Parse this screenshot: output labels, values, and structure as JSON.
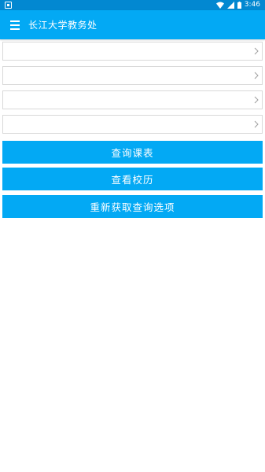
{
  "status_bar": {
    "time": "3:46",
    "icons": [
      "notification-icon",
      "wifi-icon",
      "signal-icon",
      "battery-icon"
    ]
  },
  "app_bar": {
    "title": "长江大学教务处",
    "menu_icon": "hamburger-menu-icon",
    "color": "#03a9f4"
  },
  "selectors": [
    {
      "value": ""
    },
    {
      "value": ""
    },
    {
      "value": ""
    },
    {
      "value": ""
    }
  ],
  "buttons": {
    "query_schedule": "查询课表",
    "view_calendar": "查看校历",
    "refresh_options": "重新获取查询选项"
  },
  "colors": {
    "status_bar": "#0288d1",
    "primary": "#03a9f4",
    "field_border": "#d9d9d9"
  }
}
